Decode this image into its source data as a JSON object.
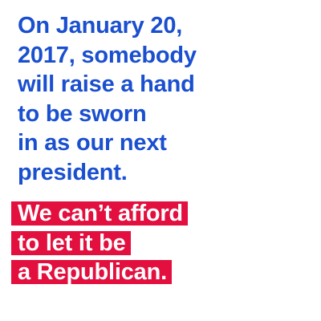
{
  "statement": {
    "lines": [
      "On January 20,",
      "2017, somebody",
      "will raise a hand",
      "to be sworn",
      "in as our next",
      "president."
    ]
  },
  "highlight": {
    "lines": [
      "We can’t afford",
      "to let it be",
      "a Republican."
    ]
  },
  "colors": {
    "text_blue": "#1a4fcf",
    "highlight_red": "#e30f3e",
    "background": "#ffffff"
  }
}
